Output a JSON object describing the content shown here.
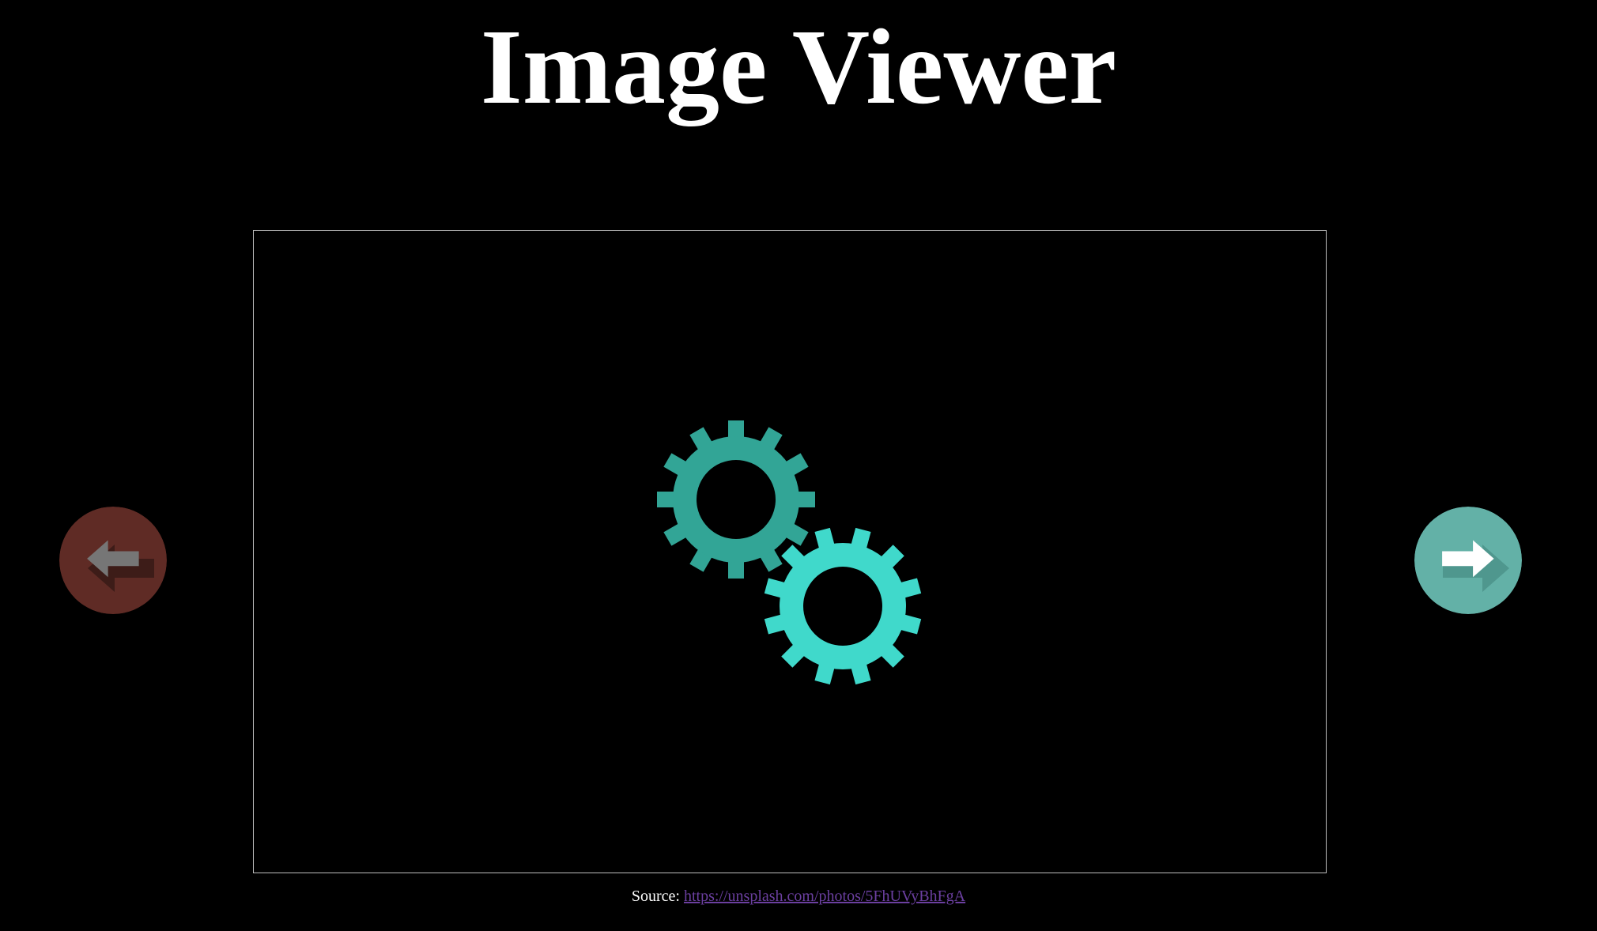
{
  "page": {
    "title": "Image Viewer"
  },
  "viewer": {
    "image_icon": "gears-icon",
    "gear_colors": [
      "#32a596",
      "#40d9cb"
    ]
  },
  "navigation": {
    "prev_icon": "arrow-left-icon",
    "next_icon": "arrow-right-icon",
    "prev_color": "#5f2b25",
    "next_color": "#63b1a7"
  },
  "source": {
    "label": "Source:",
    "url": "https://unsplash.com/photos/5FhUVyBhFgA"
  }
}
